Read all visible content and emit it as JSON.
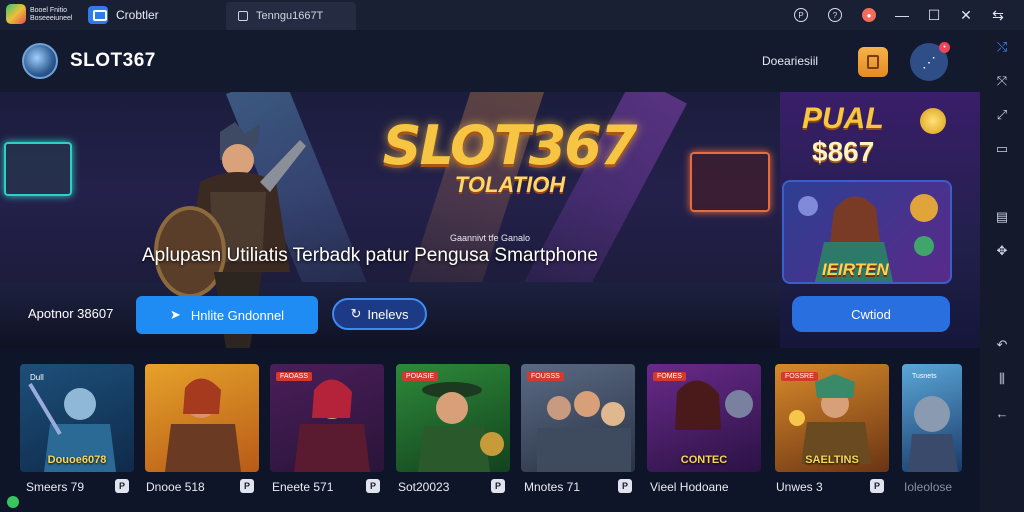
{
  "titlebar": {
    "logo_line1": "Booel Fnitio",
    "logo_line2": "Boseeeiuneel",
    "app_name": "Crobtler",
    "tab_title": "Tenngu1667T",
    "icons": [
      "pause-circle-icon",
      "help-circle-icon",
      "notification-icon",
      "minimize-icon",
      "maximize-icon",
      "close-icon",
      "restore-icon"
    ]
  },
  "header": {
    "brand": "SLOT367",
    "download_label": "Doeariesiil"
  },
  "hero": {
    "title": "SLOT367",
    "subtitle": "TOLATIOH",
    "small_tag": "Gaannivt tfe Ganalo",
    "tagline": "Aplupasn Utiliatis Terbadk patur Pengusa Smartphone",
    "app_label": "Apotnor 38607",
    "primary_button": "Hnlite Gndonnel",
    "secondary_button": "Inelevs"
  },
  "promo": {
    "title": "PUAL",
    "amount": "$867",
    "card_title": "IEIRTEN",
    "button": "Cwtiod"
  },
  "games": [
    {
      "label": "Smeers 79",
      "badge": "Dull",
      "art_title": "Douoe6078"
    },
    {
      "label": "Dnooe 518",
      "badge": "",
      "art_title": ""
    },
    {
      "label": "Eneete 571",
      "badge": "FAOASS",
      "art_title": ""
    },
    {
      "label": "Sot20023",
      "badge": "POIASIE",
      "art_title": ""
    },
    {
      "label": "Mnotes 71",
      "badge": "FOUSSS",
      "art_title": ""
    },
    {
      "label": "Vieel Hodoane",
      "badge": "FOMES",
      "art_title": "CONTEC"
    },
    {
      "label": "Unwes 3",
      "badge": "FOSSRE",
      "art_title": "SAELTINS"
    },
    {
      "label": "Ioleolose",
      "badge": "Tusnets",
      "art_title": ""
    }
  ],
  "colors": {
    "accent": "#1f8cf3",
    "titlebar": "#1a2033",
    "background": "#0d1426",
    "gold": "#f7c544"
  },
  "sidebar": {
    "icons": [
      "shuffle-icon",
      "expand-icon",
      "resize-icon",
      "screen-icon",
      "note-icon",
      "puzzle-icon",
      "back-icon",
      "recents-icon",
      "home-arrow-icon"
    ]
  }
}
